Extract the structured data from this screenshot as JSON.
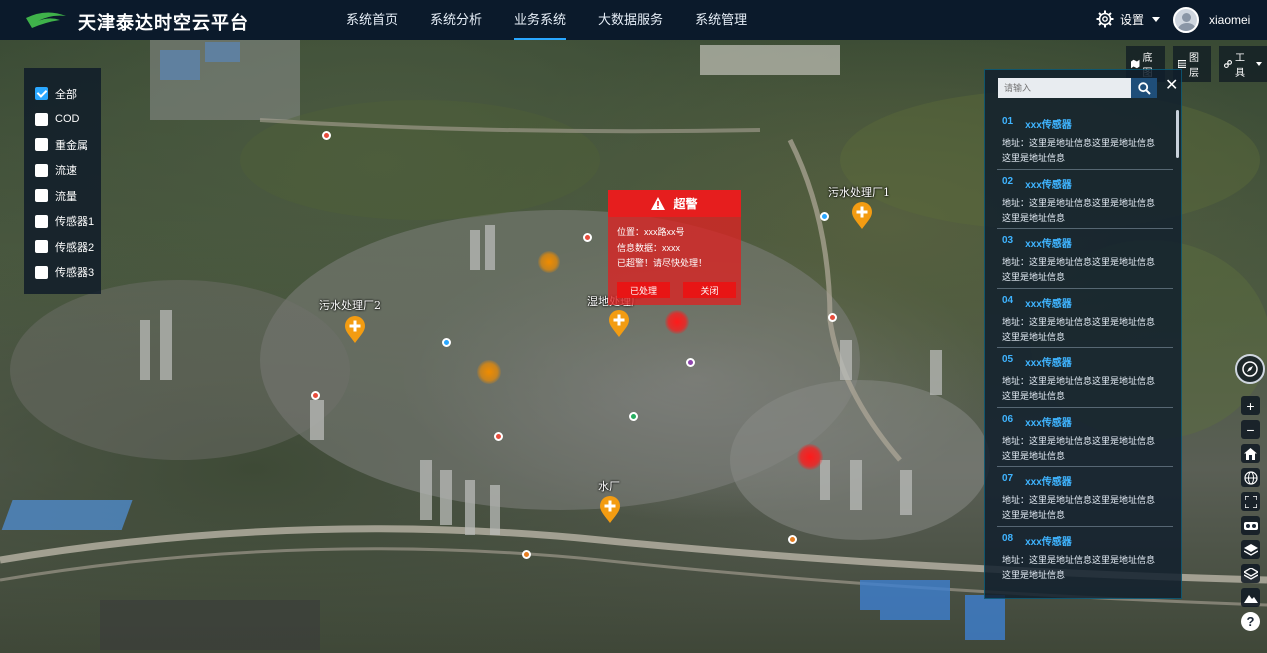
{
  "header": {
    "title": "天津泰达时空云平台",
    "nav": [
      "系统首页",
      "系统分析",
      "业务系统",
      "大数据服务",
      "系统管理"
    ],
    "active_nav": 2,
    "settings_label": "设置",
    "username": "xiaomei"
  },
  "toolbar": {
    "basemap": "底图",
    "layers": "图层",
    "tools": "工具"
  },
  "filters": [
    {
      "label": "全部",
      "checked": true
    },
    {
      "label": "COD",
      "checked": false
    },
    {
      "label": "重金属",
      "checked": false
    },
    {
      "label": "流速",
      "checked": false
    },
    {
      "label": "流量",
      "checked": false
    },
    {
      "label": "传感器1",
      "checked": false
    },
    {
      "label": "传感器2",
      "checked": false
    },
    {
      "label": "传感器3",
      "checked": false
    }
  ],
  "search": {
    "placeholder": "请输入"
  },
  "sensors": [
    {
      "num": "01",
      "name": "xxx传感器",
      "address": "地址：这里是地址信息这里是地址信息这里是地址信息"
    },
    {
      "num": "02",
      "name": "xxx传感器",
      "address": "地址：这里是地址信息这里是地址信息这里是地址信息"
    },
    {
      "num": "03",
      "name": "xxx传感器",
      "address": "地址：这里是地址信息这里是地址信息这里是地址信息"
    },
    {
      "num": "04",
      "name": "xxx传感器",
      "address": "地址：这里是地址信息这里是地址信息这里是地址信息"
    },
    {
      "num": "05",
      "name": "xxx传感器",
      "address": "地址：这里是地址信息这里是地址信息这里是地址信息"
    },
    {
      "num": "06",
      "name": "xxx传感器",
      "address": "地址：这里是地址信息这里是地址信息这里是地址信息"
    },
    {
      "num": "07",
      "name": "xxx传感器",
      "address": "地址：这里是地址信息这里是地址信息这里是地址信息"
    },
    {
      "num": "08",
      "name": "xxx传感器",
      "address": "地址：这里是地址信息这里是地址信息这里是地址信息"
    }
  ],
  "alarm": {
    "title": "超警",
    "location": "位置：xxx路xx号",
    "info": "信息数据：xxxx",
    "message": "已超警！请尽快处理！",
    "handled_btn": "已处理",
    "close_btn": "关闭"
  },
  "map_labels": {
    "plant1": "污水处理厂1",
    "plant2": "污水处理厂2",
    "plant3": "湿地处理厂",
    "plant4": "水厂"
  },
  "colors": {
    "header_bg": "#0b1a2b",
    "accent": "#2aa7ff",
    "alarm": "#e61e1e",
    "pin": "#f39c12"
  }
}
